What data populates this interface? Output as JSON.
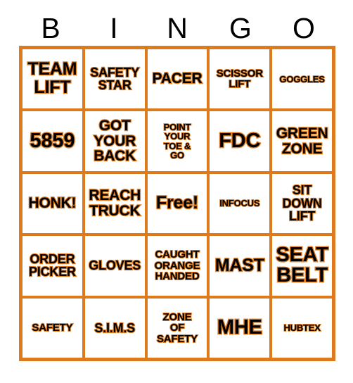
{
  "card": {
    "title": "BINGO",
    "accent_color": "#dd7a1d",
    "text_color": "#000000",
    "background_color": "#ffffff",
    "columns": 5,
    "rows": 5
  },
  "header": {
    "letters": [
      {
        "label": "B"
      },
      {
        "label": "I"
      },
      {
        "label": "N"
      },
      {
        "label": "G"
      },
      {
        "label": "O"
      }
    ]
  },
  "grid": {
    "rows": [
      {
        "cells": [
          {
            "text": "TEAM\nLIFT",
            "size": "sz-l",
            "free": false
          },
          {
            "text": "SAFETY\nSTAR",
            "size": "sz-s",
            "free": false
          },
          {
            "text": "PACER",
            "size": "sz-m",
            "free": false
          },
          {
            "text": "SCISSOR\nLIFT",
            "size": "sz-xs",
            "free": false
          },
          {
            "text": "GOGGLES",
            "size": "sz-xxs",
            "free": false
          }
        ]
      },
      {
        "cells": [
          {
            "text": "5859",
            "size": "sz-xl",
            "free": false
          },
          {
            "text": "GOT\nYOUR\nBACK",
            "size": "sz-m",
            "free": false
          },
          {
            "text": "POINT\nYOUR\nTOE &\nGO",
            "size": "sz-xxs",
            "free": false
          },
          {
            "text": "FDC",
            "size": "sz-xl",
            "free": false
          },
          {
            "text": "GREEN\nZONE",
            "size": "sz-m",
            "free": false
          }
        ]
      },
      {
        "cells": [
          {
            "text": "HONK!",
            "size": "sz-m",
            "free": false
          },
          {
            "text": "REACH\nTRUCK",
            "size": "sz-m",
            "free": false
          },
          {
            "text": "Free!",
            "size": "sz-l",
            "free": true
          },
          {
            "text": "INFOCUS",
            "size": "sz-xxs",
            "free": false
          },
          {
            "text": "SIT\nDOWN\nLIFT",
            "size": "sz-s",
            "free": false
          }
        ]
      },
      {
        "cells": [
          {
            "text": "ORDER\nPICKER",
            "size": "sz-s",
            "free": false
          },
          {
            "text": "GLOVES",
            "size": "sz-s",
            "free": false
          },
          {
            "text": "CAUGHT\nORANGE\nHANDED",
            "size": "sz-xs",
            "free": false
          },
          {
            "text": "MAST",
            "size": "sz-l",
            "free": false
          },
          {
            "text": "SEAT\nBELT",
            "size": "sz-xl",
            "free": false
          }
        ]
      },
      {
        "cells": [
          {
            "text": "SAFETY",
            "size": "sz-xs",
            "free": false
          },
          {
            "text": "S.I.M.S",
            "size": "sz-s",
            "free": false
          },
          {
            "text": "ZONE\nOF\nSAFETY",
            "size": "sz-xs",
            "free": false
          },
          {
            "text": "MHE",
            "size": "sz-xl",
            "free": false
          },
          {
            "text": "HUBTEX",
            "size": "sz-xxs",
            "free": false
          }
        ]
      }
    ]
  }
}
